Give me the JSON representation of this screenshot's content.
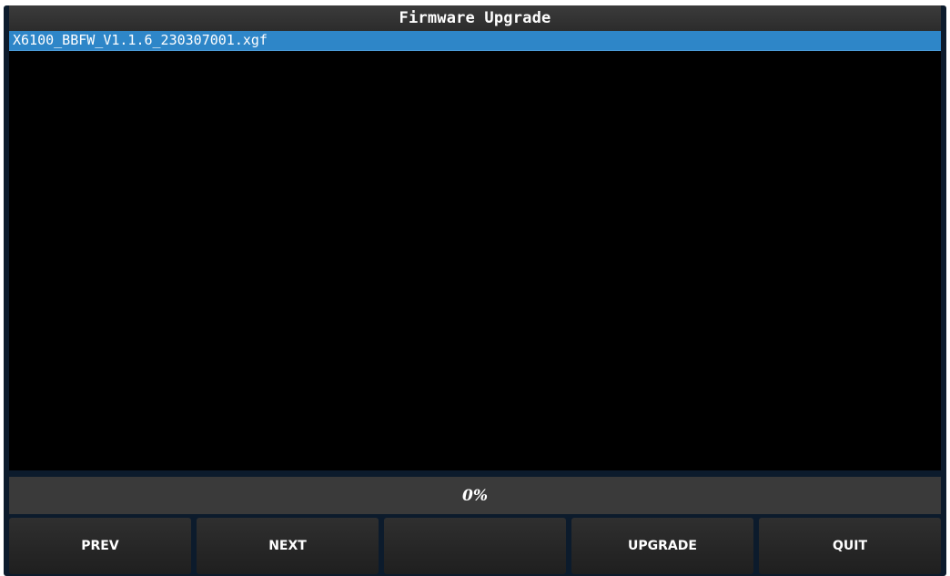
{
  "title": "Firmware Upgrade",
  "files": [
    {
      "name": "X6100_BBFW_V1.1.6_230307001.xgf",
      "selected": true
    }
  ],
  "progress": {
    "value": 0,
    "label": "0%"
  },
  "buttons": {
    "prev": "PREV",
    "next": "NEXT",
    "empty": "",
    "upgrade": "UPGRADE",
    "quit": "QUIT"
  },
  "colors": {
    "selection": "#2e86c8",
    "titlebar": "#333333",
    "list_background": "#000000",
    "button": "#262626",
    "frame": "#0c1b2c"
  }
}
